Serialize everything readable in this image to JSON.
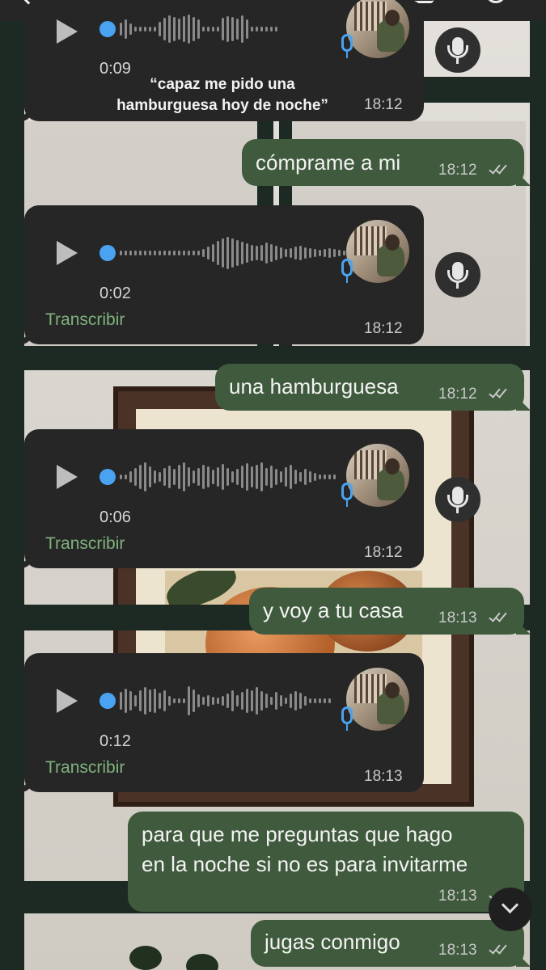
{
  "messages": {
    "voice1": {
      "duration": "0:09",
      "transcript_line1": "“capaz me pido una",
      "transcript_line2": "hamburguesa hoy de noche”",
      "time": "18:12"
    },
    "out1": {
      "text": "cómprame a mi",
      "time": "18:12"
    },
    "voice2": {
      "duration": "0:02",
      "transcribe_label": "Transcribir",
      "time": "18:12"
    },
    "out2": {
      "text": "una hamburguesa",
      "time": "18:12"
    },
    "voice3": {
      "duration": "0:06",
      "transcribe_label": "Transcribir",
      "time": "18:12"
    },
    "out3": {
      "text": "y voy a tu casa",
      "time": "18:13"
    },
    "voice4": {
      "duration": "0:12",
      "transcribe_label": "Transcribir",
      "time": "18:13"
    },
    "out4": {
      "line1": "para que me preguntas que hago",
      "line2": "en la noche si no es para invitarme",
      "time": "18:13"
    },
    "out5": {
      "text": "jugas conmigo",
      "time": "18:13"
    }
  },
  "icons": {
    "play": "play-icon",
    "mic": "microphone-icon",
    "read_receipt": "double-check-icon",
    "scroll": "chevron-down-icon"
  },
  "colors": {
    "incoming_bubble": "#262626",
    "outgoing_bubble": "#3f5a3c",
    "voice_progress": "#4aa3f0",
    "transcribe_link": "#7fb27d"
  }
}
